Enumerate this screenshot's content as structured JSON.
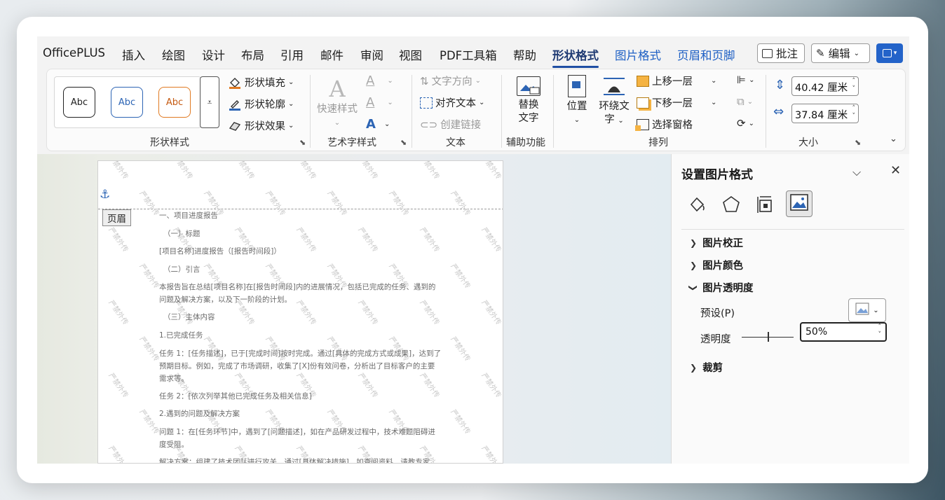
{
  "menu": {
    "tabs": [
      "OfficePLUS",
      "插入",
      "绘图",
      "设计",
      "布局",
      "引用",
      "邮件",
      "审阅",
      "视图",
      "PDF工具箱",
      "帮助",
      "形状格式",
      "图片格式",
      "页眉和页脚"
    ],
    "active_tab": "形状格式",
    "comment_label": "批注",
    "edit_label": "编辑"
  },
  "ribbon": {
    "shape_styles": {
      "samples": [
        "Abc",
        "Abc",
        "Abc"
      ],
      "fill": "形状填充",
      "outline": "形状轮廓",
      "effects": "形状效果",
      "group_label": "形状样式"
    },
    "wordart": {
      "quick_styles": "快速样式",
      "group_label": "艺术字样式"
    },
    "text": {
      "direction": "文字方向",
      "align": "对齐文本",
      "link": "创建链接",
      "group_label": "文本"
    },
    "accessibility": {
      "alt_text_line1": "替换",
      "alt_text_line2": "文字",
      "group_label": "辅助功能"
    },
    "arrange": {
      "position": "位置",
      "wrap_line1": "环绕文",
      "wrap_line2": "字",
      "bring_forward": "上移一层",
      "send_backward": "下移一层",
      "selection_pane": "选择窗格",
      "group_label": "排列"
    },
    "size": {
      "height": "40.42 厘米",
      "width": "37.84 厘米",
      "group_label": "大小"
    }
  },
  "document": {
    "header_tag": "页眉",
    "watermark": "严禁外传",
    "lines": [
      "一、项目进度报告",
      "（一）标题",
      "[项目名称]进度报告（[报告时间段]）",
      "（二）引言",
      "本报告旨在总结[项目名称]在[报告时间段]内的进展情况，包括已完成的任务、遇到的",
      "问题及解决方案，以及下一阶段的计划。",
      "（三）主体内容",
      "1.已完成任务",
      "任务 1：[任务描述]，已于[完成时间]按时完成。通过[具体的完成方式或成果]，达到了",
      "预期目标。例如，完成了市场调研，收集了[X]份有效问卷，分析出了目标客户的主要",
      "需求等。",
      "任务 2：[依次列举其他已完成任务及相关信息]",
      "2.遇到的问题及解决方案",
      "问题 1：在[任务环节]中，遇到了[问题描述]，如在产品研发过程中，技术难题阻碍进",
      "度受阻。",
      "解决方案：组建了技术团队进行攻关，通过[具体解决措施]，如查阅资料、请教专家"
    ]
  },
  "pane": {
    "title": "设置图片格式",
    "sections": {
      "correction": "图片校正",
      "color": "图片颜色",
      "transparency": "图片透明度",
      "crop": "裁剪"
    },
    "preset_label": "预设(P)",
    "transparency_label": "透明度",
    "transparency_value": "50%",
    "transparency_level": 0.5
  },
  "colors": {
    "accent": "#1f4ea3",
    "share": "#2363c9"
  }
}
